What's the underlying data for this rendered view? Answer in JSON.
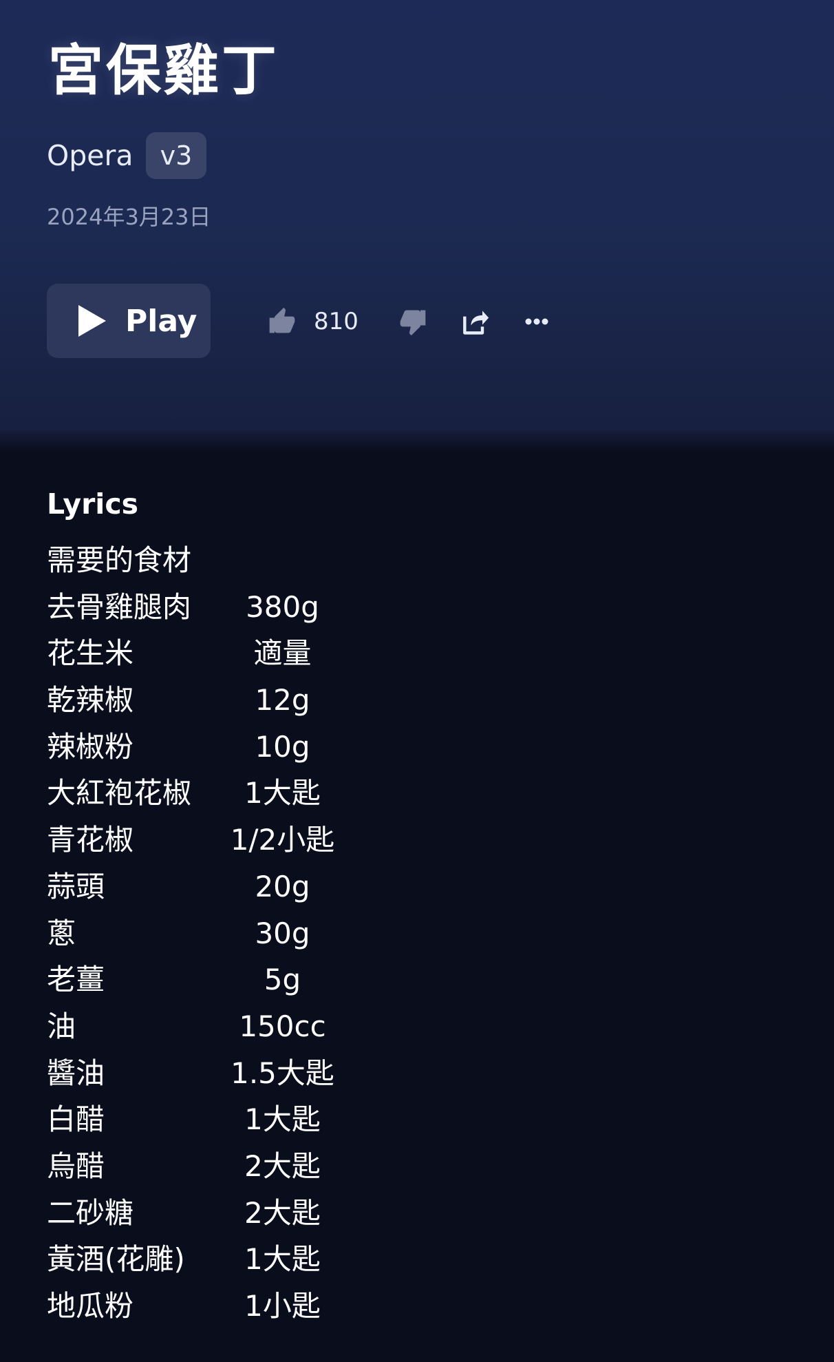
{
  "song": {
    "title": "宮保雞丁",
    "artist": "Opera",
    "version": "v3",
    "date": "2024年3月23日"
  },
  "actions": {
    "play_label": "Play",
    "like_count": "810"
  },
  "icons": [
    "play-icon",
    "thumbs-up-icon",
    "thumbs-down-icon",
    "share-icon",
    "more-icon"
  ],
  "colors": {
    "header_bg": "#1d2a57",
    "page_bg": "#0a0d1c",
    "button_bg": "#2e385c",
    "badge_bg": "#3a4468",
    "muted_text": "#9aa3bf"
  },
  "lyrics": {
    "heading": "Lyrics",
    "intro": "需要的食材",
    "lines": [
      {
        "name": "去骨雞腿肉",
        "qty": "380g"
      },
      {
        "name": "花生米",
        "qty": "適量"
      },
      {
        "name": "乾辣椒",
        "qty": "12g"
      },
      {
        "name": "辣椒粉",
        "qty": "10g"
      },
      {
        "name": "大紅袍花椒",
        "qty": "1大匙"
      },
      {
        "name": "青花椒",
        "qty": "1/2小匙"
      },
      {
        "name": "蒜頭",
        "qty": "20g"
      },
      {
        "name": "蔥",
        "qty": "30g"
      },
      {
        "name": "老薑",
        "qty": "5g"
      },
      {
        "name": "油",
        "qty": "150cc"
      },
      {
        "name": "醬油",
        "qty": "1.5大匙"
      },
      {
        "name": "白醋",
        "qty": "1大匙"
      },
      {
        "name": "烏醋",
        "qty": "2大匙"
      },
      {
        "name": "二砂糖",
        "qty": "2大匙"
      },
      {
        "name": "黃酒(花雕)",
        "qty": "1大匙"
      },
      {
        "name": "地瓜粉",
        "qty": "1小匙"
      }
    ]
  }
}
